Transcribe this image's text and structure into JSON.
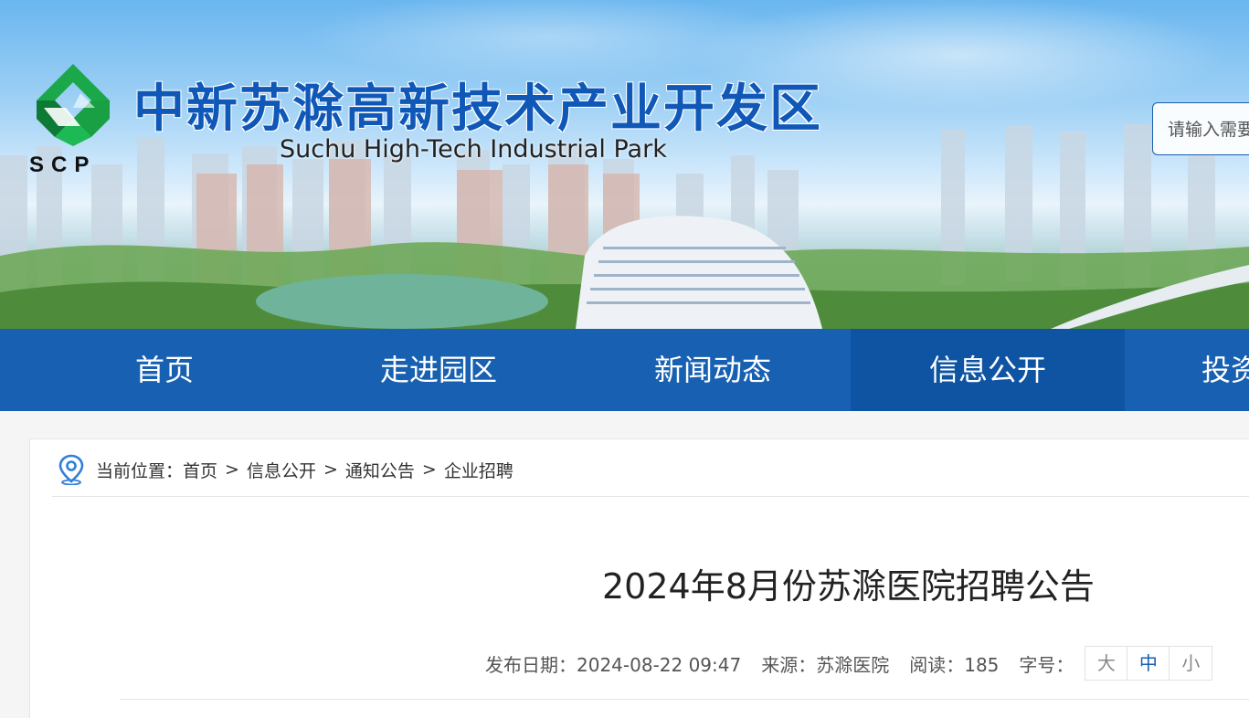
{
  "header": {
    "title_cn": "中新苏滁高新技术产业开发区",
    "title_en": "Suchu High-Tech Industrial Park",
    "logo_text": "SCP",
    "search": {
      "placeholder": "请输入需要搜索的内容"
    }
  },
  "nav": {
    "items": [
      {
        "label": "首页"
      },
      {
        "label": "走进园区"
      },
      {
        "label": "新闻动态"
      },
      {
        "label": "信息公开"
      },
      {
        "label": "投资"
      }
    ],
    "active": "信息公开"
  },
  "breadcrumb": {
    "prefix": "当前位置：",
    "items": [
      "首页",
      "信息公开",
      "通知公告",
      "企业招聘"
    ],
    "separator": ">"
  },
  "article": {
    "title": "2024年8月份苏滁医院招聘公告",
    "publish_date_label": "发布日期：2024-08-22 09:47",
    "source_label": "来源：苏滁医院",
    "views_label": "阅读：185",
    "font_size_label": "字号：",
    "font_sizes": [
      "大",
      "中",
      "小"
    ],
    "font_size_active": "中"
  },
  "colors": {
    "nav_bg": "#1760b2",
    "nav_active": "#0f54a3",
    "title_blue": "#1058b8",
    "logo_green": "#1aa84a"
  },
  "icons": {
    "location": "location-pin-icon",
    "logo": "scp-logo-icon"
  }
}
